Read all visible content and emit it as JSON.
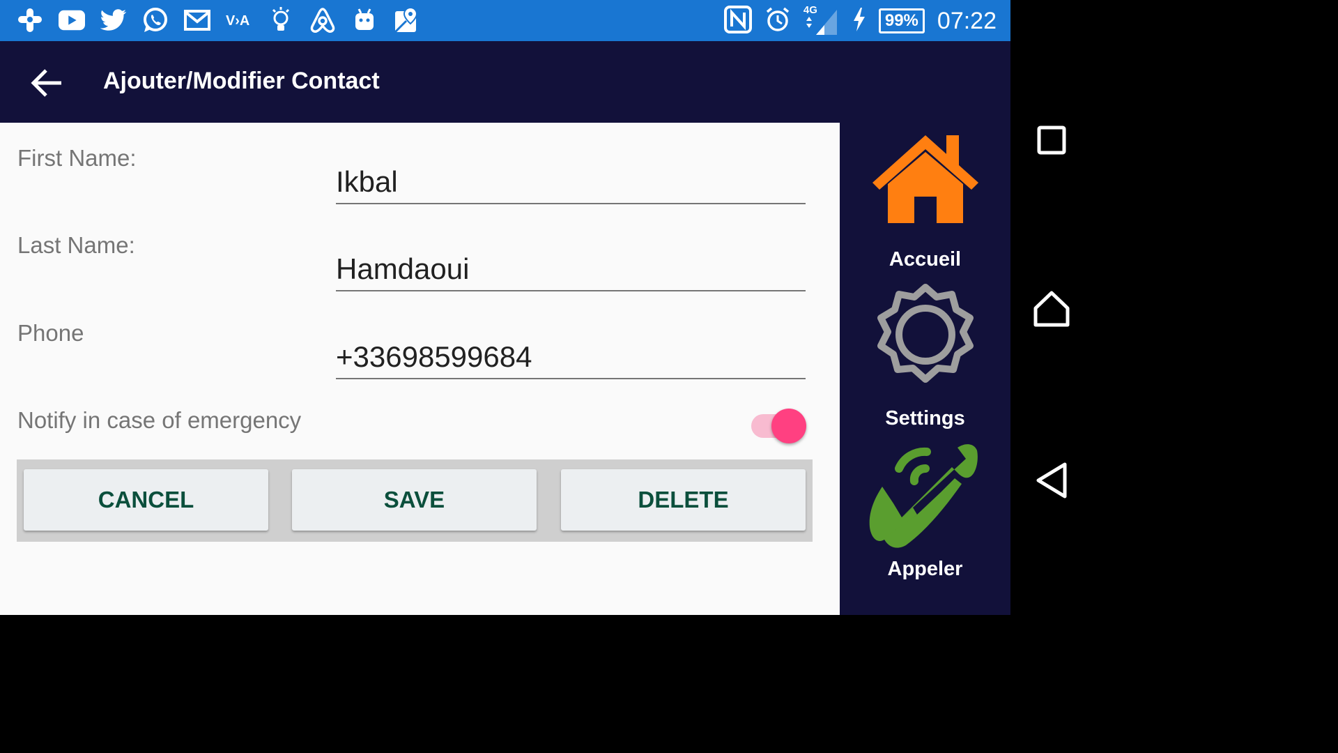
{
  "status_bar": {
    "left_icons": [
      "plus-app-icon",
      "youtube-icon",
      "twitter-icon",
      "whatsapp-icon",
      "gmail-icon",
      "vlc-icon",
      "lightbulb-icon",
      "airbnb-icon",
      "android-icon",
      "maps-icon"
    ],
    "network": "4G",
    "battery": "99%",
    "time": "07:22"
  },
  "app_bar": {
    "title": "Ajouter/Modifier Contact"
  },
  "form": {
    "first_name": {
      "label": "First Name:",
      "value": "Ikbal"
    },
    "last_name": {
      "label": "Last Name:",
      "value": "Hamdaoui"
    },
    "phone": {
      "label": "Phone",
      "value": "+33698599684"
    },
    "notify": {
      "label": "Notify in case of emergency",
      "checked": true
    }
  },
  "buttons": {
    "cancel": "CANCEL",
    "save": "SAVE",
    "delete": "DELETE"
  },
  "sidebar": {
    "items": [
      {
        "label": "Accueil",
        "icon": "home-icon"
      },
      {
        "label": "Settings",
        "icon": "gear-icon"
      },
      {
        "label": "Appeler",
        "icon": "phone-icon"
      }
    ]
  },
  "colors": {
    "status_bar": "#1976d2",
    "app_bar": "#12113a",
    "accent": "#ff4081",
    "home_icon": "#ff7f11",
    "settings_icon": "#9e9e9e",
    "phone_icon": "#5a9e2f"
  }
}
